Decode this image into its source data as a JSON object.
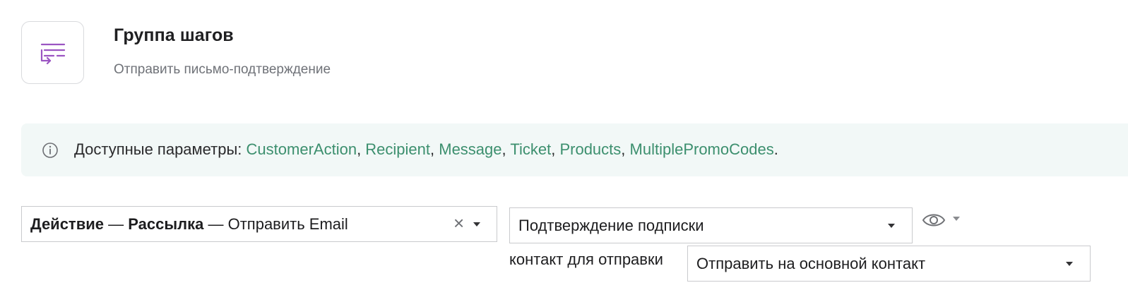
{
  "step_group": {
    "icon": "step-group-icon",
    "title": "Группа шагов",
    "subtitle": "Отправить письмо-подтверждение"
  },
  "info_banner": {
    "icon": "info-circle-icon",
    "prefix": "Доступные параметры:",
    "params": [
      "CustomerAction",
      "Recipient",
      "Message",
      "Ticket",
      "Products",
      "MultiplePromoCodes"
    ],
    "suffix": ".",
    "link_color": "#3c8f6e",
    "background": "#f2f8f7"
  },
  "action_select": {
    "part1": "Действие",
    "sep1": "—",
    "part2": "Рассылка",
    "sep2": "—",
    "part3": "Отправить Email",
    "clear_icon": "close-icon",
    "caret_icon": "chevron-down-icon"
  },
  "template_select": {
    "value": "Подтверждение подписки",
    "caret_icon": "chevron-down-icon"
  },
  "preview": {
    "icon": "eye-icon",
    "caret_icon": "chevron-down-icon"
  },
  "contact": {
    "label": "контакт для отправки",
    "value": "Отправить на основной контакт",
    "caret_icon": "chevron-down-icon"
  }
}
